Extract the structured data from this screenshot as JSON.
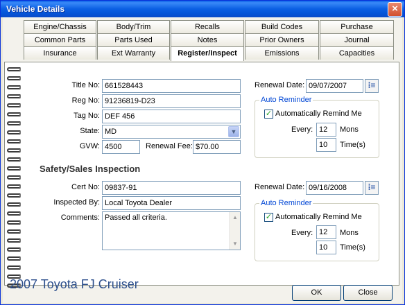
{
  "window": {
    "title": "Vehicle Details",
    "close_glyph": "×"
  },
  "tabs": {
    "row1": [
      "Engine/Chassis",
      "Body/Trim",
      "Recalls",
      "Build Codes",
      "Purchase"
    ],
    "row2": [
      "Common Parts",
      "Parts Used",
      "Notes",
      "Prior Owners",
      "Journal"
    ],
    "row3": [
      "Insurance",
      "Ext Warranty",
      "Register/Inspect",
      "Emissions",
      "Capacities"
    ],
    "active": "Register/Inspect"
  },
  "registration": {
    "title_no_label": "Title No:",
    "title_no": "661528443",
    "reg_no_label": "Reg No:",
    "reg_no": "91236819-D23",
    "tag_no_label": "Tag No:",
    "tag_no": "DEF 456",
    "state_label": "State:",
    "state": "MD",
    "gvw_label": "GVW:",
    "gvw": "4500",
    "renewal_fee_label": "Renewal Fee:",
    "renewal_fee": "$70.00",
    "renewal_date_label": "Renewal Date:",
    "renewal_date": "09/07/2007",
    "auto_reminder_label": "Auto Reminder",
    "remind_checkbox_label": "Automatically Remind Me",
    "remind_checked": true,
    "every_label": "Every:",
    "every_value": "12",
    "every_unit": "Mons",
    "times_value": "10",
    "times_unit": "Time(s)"
  },
  "inspection": {
    "section_title": "Safety/Sales Inspection",
    "cert_no_label": "Cert No:",
    "cert_no": "09837-91",
    "inspected_by_label": "Inspected By:",
    "inspected_by": "Local Toyota Dealer",
    "comments_label": "Comments:",
    "comments": "Passed all criteria.",
    "renewal_date_label": "Renewal Date:",
    "renewal_date": "09/16/2008",
    "auto_reminder_label": "Auto Reminder",
    "remind_checkbox_label": "Automatically Remind Me",
    "remind_checked": true,
    "every_label": "Every:",
    "every_value": "12",
    "every_unit": "Mons",
    "times_value": "10",
    "times_unit": "Time(s)"
  },
  "footer": {
    "vehicle_name": "2007 Toyota FJ Cruiser",
    "ok_label": "OK",
    "close_label": "Close"
  },
  "icons": {
    "dropdown_arrow": "chevron-down-icon",
    "calendar": "calendar-icon",
    "check": "checkmark-icon",
    "scroll_up": "scroll-up-arrow-icon",
    "scroll_down": "scroll-down-arrow-icon"
  }
}
